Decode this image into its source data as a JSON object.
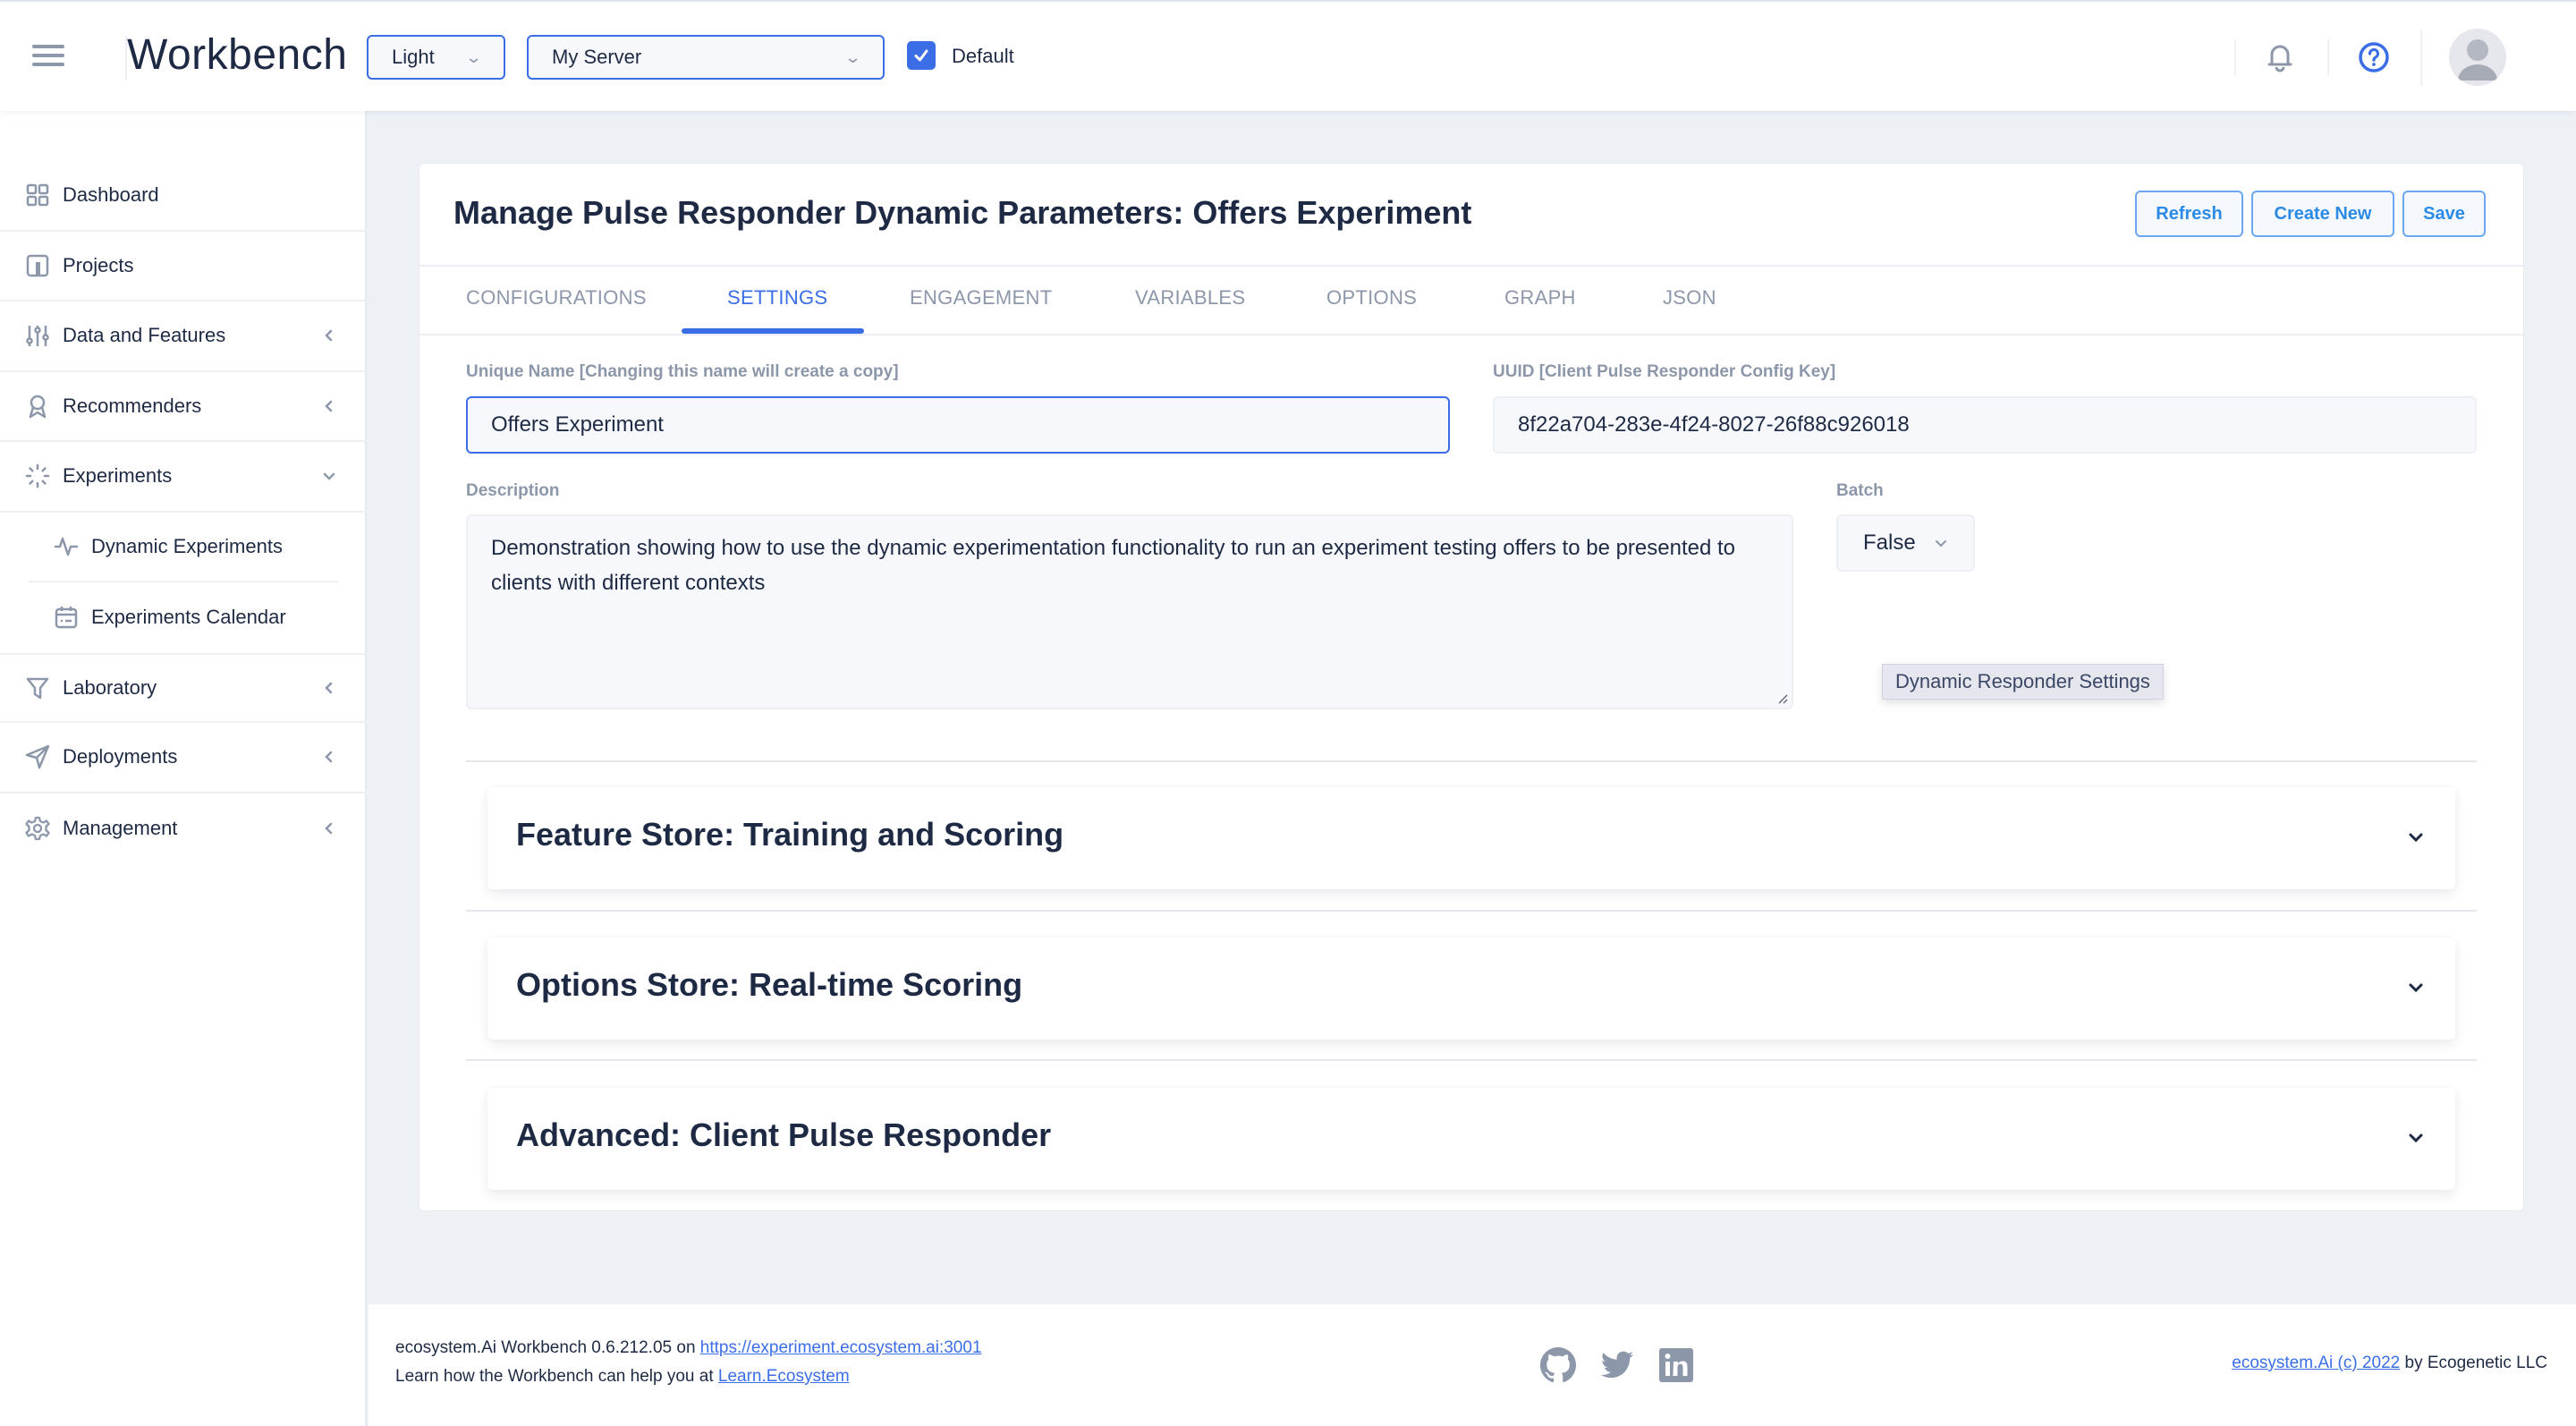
{
  "header": {
    "app_title": "Workbench",
    "theme_select": {
      "value": "Light"
    },
    "server_select": {
      "value": "My Server"
    },
    "default_checkbox": {
      "label": "Default",
      "checked": true
    },
    "icons": [
      "menu-icon",
      "bell-icon",
      "help-icon",
      "avatar"
    ]
  },
  "sidebar": {
    "items": [
      {
        "label": "Dashboard",
        "icon": "grid-icon",
        "expandable": false
      },
      {
        "label": "Projects",
        "icon": "project-icon",
        "expandable": false
      },
      {
        "label": "Data and Features",
        "icon": "sliders-icon",
        "expandable": true,
        "expanded": false
      },
      {
        "label": "Recommenders",
        "icon": "award-icon",
        "expandable": true,
        "expanded": false
      },
      {
        "label": "Experiments",
        "icon": "loader-icon",
        "expandable": true,
        "expanded": true,
        "children": [
          {
            "label": "Dynamic Experiments",
            "icon": "activity-icon"
          },
          {
            "label": "Experiments Calendar",
            "icon": "calendar-icon"
          }
        ]
      },
      {
        "label": "Laboratory",
        "icon": "filter-icon",
        "expandable": true,
        "expanded": false
      },
      {
        "label": "Deployments",
        "icon": "send-icon",
        "expandable": true,
        "expanded": false
      },
      {
        "label": "Management",
        "icon": "gear-icon",
        "expandable": true,
        "expanded": false
      }
    ]
  },
  "main": {
    "title": "Manage Pulse Responder Dynamic Parameters: Offers Experiment",
    "buttons": {
      "refresh": "Refresh",
      "create_new": "Create New",
      "save": "Save"
    },
    "tabs": [
      {
        "label": "CONFIGURATIONS",
        "active": false
      },
      {
        "label": "SETTINGS",
        "active": true
      },
      {
        "label": "ENGAGEMENT",
        "active": false
      },
      {
        "label": "VARIABLES",
        "active": false
      },
      {
        "label": "OPTIONS",
        "active": false
      },
      {
        "label": "GRAPH",
        "active": false
      },
      {
        "label": "JSON",
        "active": false
      }
    ],
    "form": {
      "unique_name": {
        "label": "Unique Name [Changing this name will create a copy]",
        "value": "Offers Experiment"
      },
      "uuid": {
        "label": "UUID [Client Pulse Responder Config Key]",
        "value": "8f22a704-283e-4f24-8027-26f88c926018"
      },
      "description": {
        "label": "Description",
        "value": "Demonstration showing how to use the dynamic experimentation functionality to run an experiment testing offers to be presented to clients with different contexts"
      },
      "batch": {
        "label": "Batch",
        "value": "False"
      }
    },
    "tooltip": "Dynamic Responder Settings",
    "accordions": [
      {
        "title": "Feature Store: Training and Scoring",
        "expanded": false
      },
      {
        "title": "Options Store: Real-time Scoring",
        "expanded": false
      },
      {
        "title": "Advanced: Client Pulse Responder",
        "expanded": false
      }
    ]
  },
  "footer": {
    "version_prefix": "ecosystem.Ai Workbench 0.6.212.05 on ",
    "server_link": "https://experiment.ecosystem.ai:3001",
    "learn_prefix": "Learn how the Workbench can help you at ",
    "learn_link": "Learn.Ecosystem",
    "social": [
      "github-icon",
      "twitter-icon",
      "linkedin-icon"
    ],
    "copyright_link": "ecosystem.Ai (c) 2022",
    "copyright_suffix": " by Ecogenetic LLC"
  },
  "colors": {
    "accent": "#3b6ee6",
    "button_text": "#2a8ae6",
    "text": "#1e2a44",
    "muted": "#8d97aa",
    "page_bg": "#edf0f5"
  }
}
